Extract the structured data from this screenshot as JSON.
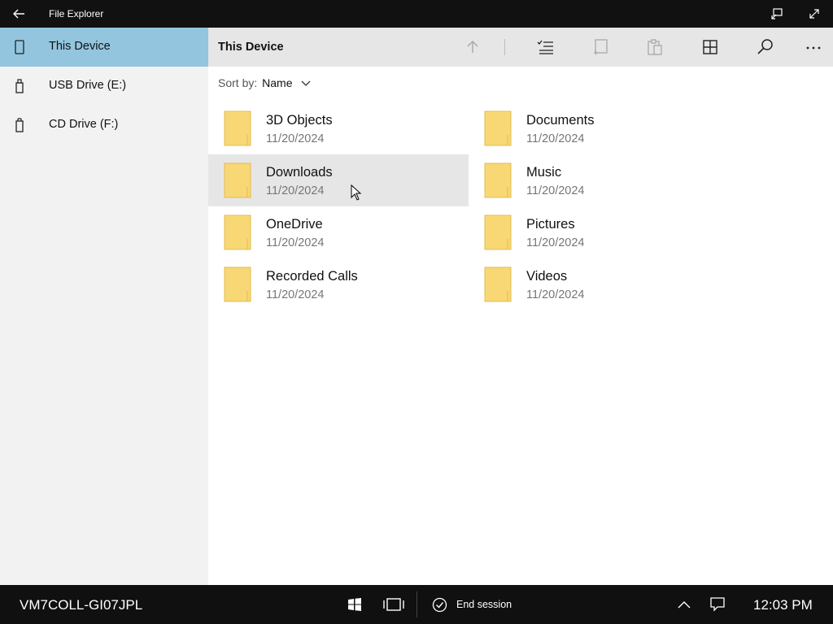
{
  "window": {
    "title": "File Explorer"
  },
  "sidebar": {
    "items": [
      {
        "label": "This Device",
        "icon": "device-icon",
        "selected": true
      },
      {
        "label": "USB Drive (E:)",
        "icon": "usb-drive-icon",
        "selected": false
      },
      {
        "label": "CD Drive (F:)",
        "icon": "cd-drive-icon",
        "selected": false
      }
    ]
  },
  "toolbar": {
    "location": "This Device",
    "commands": [
      "up-arrow-icon",
      "select-icon",
      "new-folder-icon",
      "paste-icon",
      "view-icon",
      "search-icon",
      "more-icon"
    ]
  },
  "sort": {
    "label": "Sort by:",
    "value": "Name"
  },
  "folders": [
    {
      "name": "3D Objects",
      "date": "11/20/2024"
    },
    {
      "name": "Documents",
      "date": "11/20/2024"
    },
    {
      "name": "Downloads",
      "date": "11/20/2024"
    },
    {
      "name": "Music",
      "date": "11/20/2024"
    },
    {
      "name": "OneDrive",
      "date": "11/20/2024"
    },
    {
      "name": "Pictures",
      "date": "11/20/2024"
    },
    {
      "name": "Recorded Calls",
      "date": "11/20/2024"
    },
    {
      "name": "Videos",
      "date": "11/20/2024"
    }
  ],
  "taskbar": {
    "host": "VM7COLL-GI07JPL",
    "end_session": "End session",
    "clock": "12:03 PM"
  },
  "colors": {
    "selected_nav": "#93c5df",
    "folder": "#f8d775",
    "hover_row": "#e6e6e6"
  }
}
